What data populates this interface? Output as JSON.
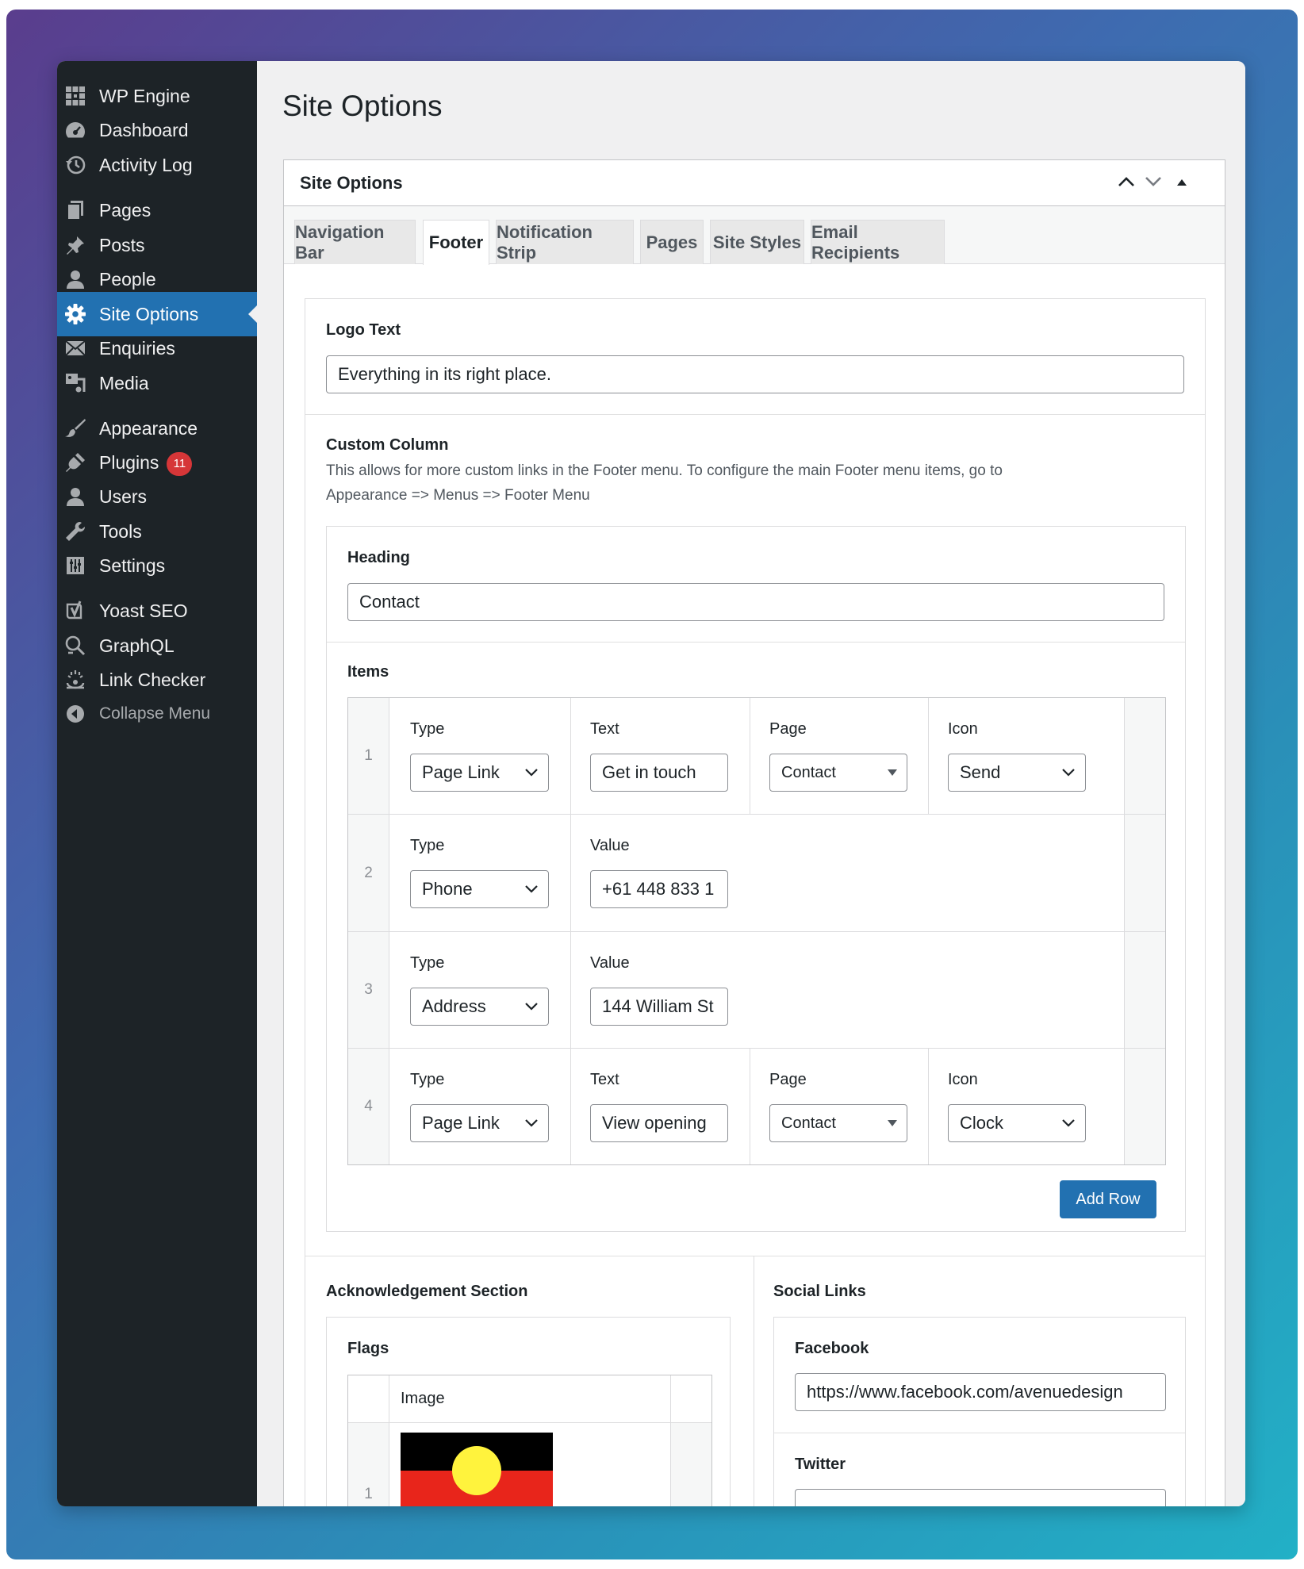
{
  "sidebar": {
    "items": [
      {
        "label": "WP Engine",
        "icon": "wpengine-icon"
      },
      {
        "label": "Dashboard",
        "icon": "dashboard-icon"
      },
      {
        "label": "Activity Log",
        "icon": "history-icon"
      },
      {
        "label": "Pages",
        "icon": "pages-icon"
      },
      {
        "label": "Posts",
        "icon": "pin-icon"
      },
      {
        "label": "People",
        "icon": "person-icon"
      },
      {
        "label": "Site Options",
        "icon": "gear-icon",
        "active": true
      },
      {
        "label": "Enquiries",
        "icon": "mail-icon"
      },
      {
        "label": "Media",
        "icon": "media-icon"
      },
      {
        "label": "Appearance",
        "icon": "brush-icon"
      },
      {
        "label": "Plugins",
        "icon": "plug-icon",
        "badge": "11"
      },
      {
        "label": "Users",
        "icon": "users-icon"
      },
      {
        "label": "Tools",
        "icon": "wrench-icon"
      },
      {
        "label": "Settings",
        "icon": "settings-icon"
      },
      {
        "label": "Yoast SEO",
        "icon": "yoast-icon"
      },
      {
        "label": "GraphQL",
        "icon": "graphql-icon"
      },
      {
        "label": "Link Checker",
        "icon": "link-checker-icon"
      }
    ],
    "collapse_label": "Collapse Menu"
  },
  "page": {
    "title": "Site Options"
  },
  "postbox": {
    "title": "Site Options",
    "tabs": [
      "Navigation Bar",
      "Footer",
      "Notification Strip",
      "Pages",
      "Site Styles",
      "Email Recipients"
    ],
    "active_tab": "Footer"
  },
  "footer": {
    "logo_text": {
      "label": "Logo Text",
      "value": "Everything in its right place."
    },
    "custom_column": {
      "label": "Custom Column",
      "description_line1": "This allows for more custom links in the Footer menu. To configure the main Footer menu items, go to",
      "description_line2": "Appearance => Menus => Footer Menu",
      "heading_label": "Heading",
      "heading_value": "Contact",
      "items_label": "Items",
      "rows": [
        {
          "num": "1",
          "type_label": "Type",
          "type": "Page Link",
          "text_label": "Text",
          "text": "Get in touch",
          "page_label": "Page",
          "page": "Contact",
          "icon_label": "Icon",
          "icon": "Send"
        },
        {
          "num": "2",
          "type_label": "Type",
          "type": "Phone",
          "value_label": "Value",
          "value": "+61 448 833 1"
        },
        {
          "num": "3",
          "type_label": "Type",
          "type": "Address",
          "value_label": "Value",
          "value": "144 William St"
        },
        {
          "num": "4",
          "type_label": "Type",
          "type": "Page Link",
          "text_label": "Text",
          "text": "View opening",
          "page_label": "Page",
          "page": "Contact",
          "icon_label": "Icon",
          "icon": "Clock"
        }
      ],
      "add_row_label": "Add Row"
    },
    "acknowledgement": {
      "label": "Acknowledgement Section",
      "flags_label": "Flags",
      "image_col_label": "Image",
      "first_row_num": "1"
    },
    "social": {
      "label": "Social Links",
      "facebook_label": "Facebook",
      "facebook_value": "https://www.facebook.com/avenuedesign",
      "twitter_label": "Twitter"
    }
  },
  "colors": {
    "accent": "#2271b1",
    "sidebar_bg": "#1d2327",
    "badge": "#d63638"
  }
}
